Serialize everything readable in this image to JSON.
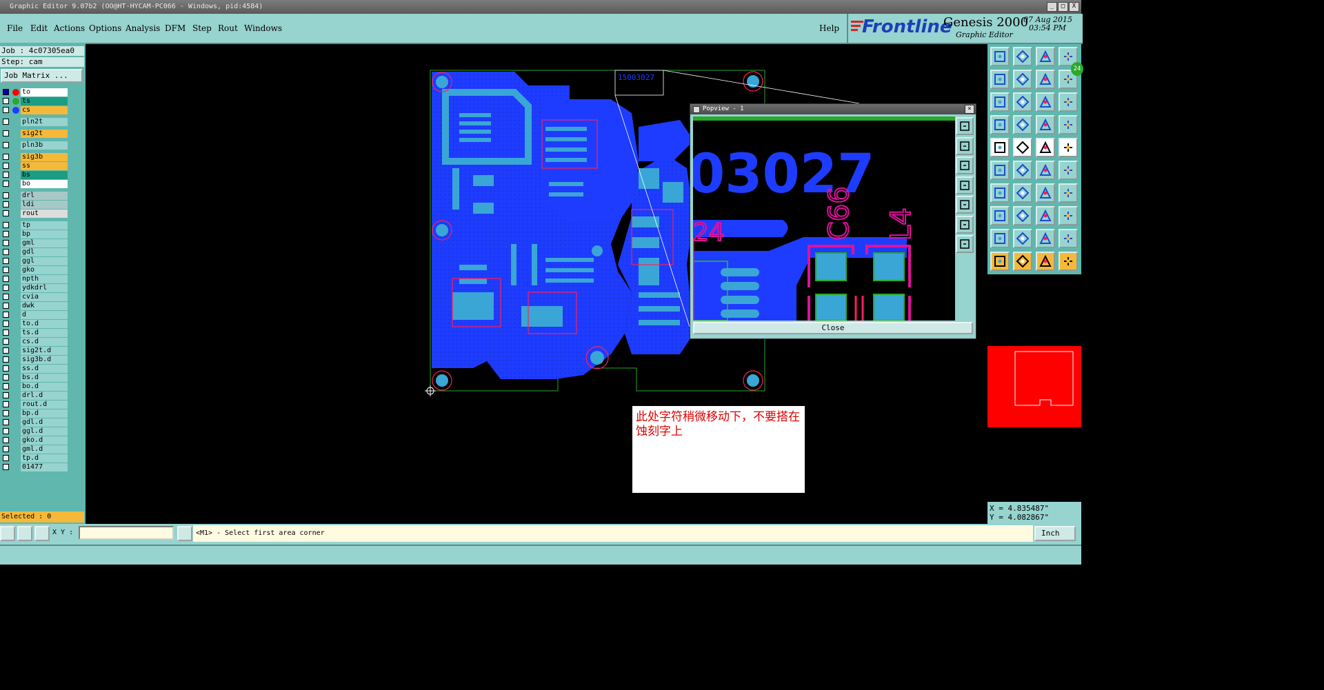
{
  "window": {
    "title": "Graphic Editor 9.07b2 (OO@HT-HYCAM-PC066 - Windows, pid:4584)",
    "minimize": "_",
    "maximize": "□",
    "close": "X"
  },
  "menu": [
    "File",
    "Edit",
    "Actions",
    "Options",
    "Analysis",
    "DFM",
    "Step",
    "Rout",
    "Windows"
  ],
  "help": "Help",
  "brand": {
    "logo": "Frontline",
    "product": "Genesis 2000",
    "subtitle": "Graphic Editor",
    "date": "07 Aug 2015",
    "time": "03:54 PM"
  },
  "job": "Job : 4c07305ea0",
  "step": "Step: cam",
  "job_matrix": "Job Matrix ...",
  "layers": [
    {
      "name": "to",
      "color": "#ffffff",
      "dot": "#ff0000",
      "group": 0
    },
    {
      "name": "ts",
      "color": "#1a9e83",
      "dot": "#2aa82a",
      "group": 0
    },
    {
      "name": "cs",
      "color": "#f5b93a",
      "dot": "#1e3cff",
      "group": 0
    },
    {
      "name": "pln2t",
      "color": "#97d3cf",
      "dot": "",
      "group": 1
    },
    {
      "name": "sig2t",
      "color": "#f5b93a",
      "dot": "",
      "group": 2
    },
    {
      "name": "pln3b",
      "color": "#97d3cf",
      "dot": "",
      "group": 3
    },
    {
      "name": "sig3b",
      "color": "#f5b93a",
      "dot": "",
      "group": 4
    },
    {
      "name": "ss",
      "color": "#f5b93a",
      "dot": "",
      "group": 4
    },
    {
      "name": "bs",
      "color": "#1a9e83",
      "dot": "",
      "group": 4
    },
    {
      "name": "bo",
      "color": "#ffffff",
      "dot": "",
      "group": 4
    },
    {
      "name": "drl",
      "color": "#a8c8c8",
      "dot": "",
      "group": 5
    },
    {
      "name": "ldi",
      "color": "#a8c8c8",
      "dot": "",
      "group": 5
    },
    {
      "name": "rout",
      "color": "#dddddd",
      "dot": "",
      "group": 5
    },
    {
      "name": "tp",
      "color": "#97d3cf",
      "dot": "",
      "group": 6
    },
    {
      "name": "bp",
      "color": "#97d3cf",
      "dot": "",
      "group": 6
    },
    {
      "name": "gml",
      "color": "#97d3cf",
      "dot": "",
      "group": 6
    },
    {
      "name": "gdl",
      "color": "#97d3cf",
      "dot": "",
      "group": 6
    },
    {
      "name": "ggl",
      "color": "#97d3cf",
      "dot": "",
      "group": 6
    },
    {
      "name": "gko",
      "color": "#97d3cf",
      "dot": "",
      "group": 6
    },
    {
      "name": "npth",
      "color": "#97d3cf",
      "dot": "",
      "group": 6
    },
    {
      "name": "ydkdrl",
      "color": "#97d3cf",
      "dot": "",
      "group": 6
    },
    {
      "name": "cvia",
      "color": "#97d3cf",
      "dot": "",
      "group": 6
    },
    {
      "name": "dwk",
      "color": "#97d3cf",
      "dot": "",
      "group": 6
    },
    {
      "name": "d",
      "color": "#97d3cf",
      "dot": "",
      "group": 6
    },
    {
      "name": "to.d",
      "color": "#97d3cf",
      "dot": "",
      "group": 6
    },
    {
      "name": "ts.d",
      "color": "#97d3cf",
      "dot": "",
      "group": 6
    },
    {
      "name": "cs.d",
      "color": "#97d3cf",
      "dot": "",
      "group": 6
    },
    {
      "name": "sig2t.d",
      "color": "#97d3cf",
      "dot": "",
      "group": 6
    },
    {
      "name": "sig3b.d",
      "color": "#97d3cf",
      "dot": "",
      "group": 6
    },
    {
      "name": "ss.d",
      "color": "#97d3cf",
      "dot": "",
      "group": 6
    },
    {
      "name": "bs.d",
      "color": "#97d3cf",
      "dot": "",
      "group": 6
    },
    {
      "name": "bo.d",
      "color": "#97d3cf",
      "dot": "",
      "group": 6
    },
    {
      "name": "drl.d",
      "color": "#97d3cf",
      "dot": "",
      "group": 6
    },
    {
      "name": "rout.d",
      "color": "#97d3cf",
      "dot": "",
      "group": 6
    },
    {
      "name": "bp.d",
      "color": "#97d3cf",
      "dot": "",
      "group": 6
    },
    {
      "name": "gdl.d",
      "color": "#97d3cf",
      "dot": "",
      "group": 6
    },
    {
      "name": "ggl.d",
      "color": "#97d3cf",
      "dot": "",
      "group": 6
    },
    {
      "name": "gko.d",
      "color": "#97d3cf",
      "dot": "",
      "group": 6
    },
    {
      "name": "gml.d",
      "color": "#97d3cf",
      "dot": "",
      "group": 6
    },
    {
      "name": "tp.d",
      "color": "#97d3cf",
      "dot": "",
      "group": 6
    },
    {
      "name": "01477",
      "color": "#97d3cf",
      "dot": "",
      "group": 6
    }
  ],
  "selected": "Selected : 0",
  "board_label": "15003027",
  "popview": {
    "title": "Popview - 1",
    "zoom_text": "03027",
    "ref1": "C66",
    "ref2": "L4",
    "ref3": "24",
    "close": "Close"
  },
  "note": "此处字符稍微移动下，不要搭在蚀刻字上",
  "badge": "24",
  "coords": {
    "x": "X = 4.835487\"",
    "y": "Y = 4.082867\""
  },
  "xy_label": "X Y :",
  "xy_value": "",
  "prompt": "<M1> - Select first area corner",
  "units": "Inch",
  "colors": {
    "panel": "#97d3cf",
    "panel_dark": "#5fb7ae",
    "copper": "#1e3cff",
    "pad": "#3aa6d6",
    "silk": "#ff1e5a",
    "outline": "#2aa82a"
  }
}
